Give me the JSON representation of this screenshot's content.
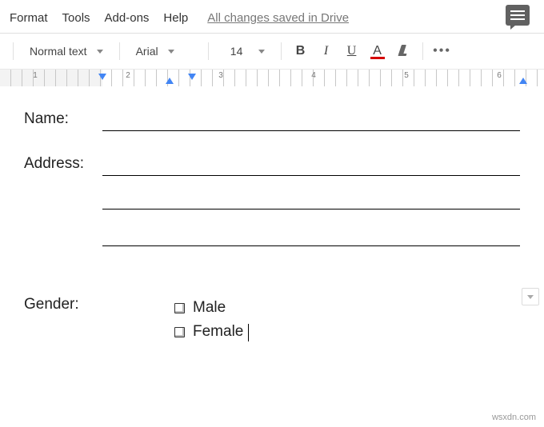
{
  "menu": {
    "format": "Format",
    "tools": "Tools",
    "addons": "Add-ons",
    "help": "Help",
    "saved": "All changes saved in Drive"
  },
  "toolbar": {
    "style": "Normal text",
    "font": "Arial",
    "size": "14",
    "bold": "B",
    "italic": "I",
    "underline": "U",
    "textcolor": "A",
    "more": "•••"
  },
  "ruler": {
    "nums": [
      "1",
      "2",
      "3",
      "4",
      "5",
      "6"
    ]
  },
  "form": {
    "name_label": "Name:",
    "address_label": "Address:",
    "gender_label": "Gender:",
    "options": [
      "Male",
      "Female"
    ]
  },
  "watermark": "wsxdn.com"
}
